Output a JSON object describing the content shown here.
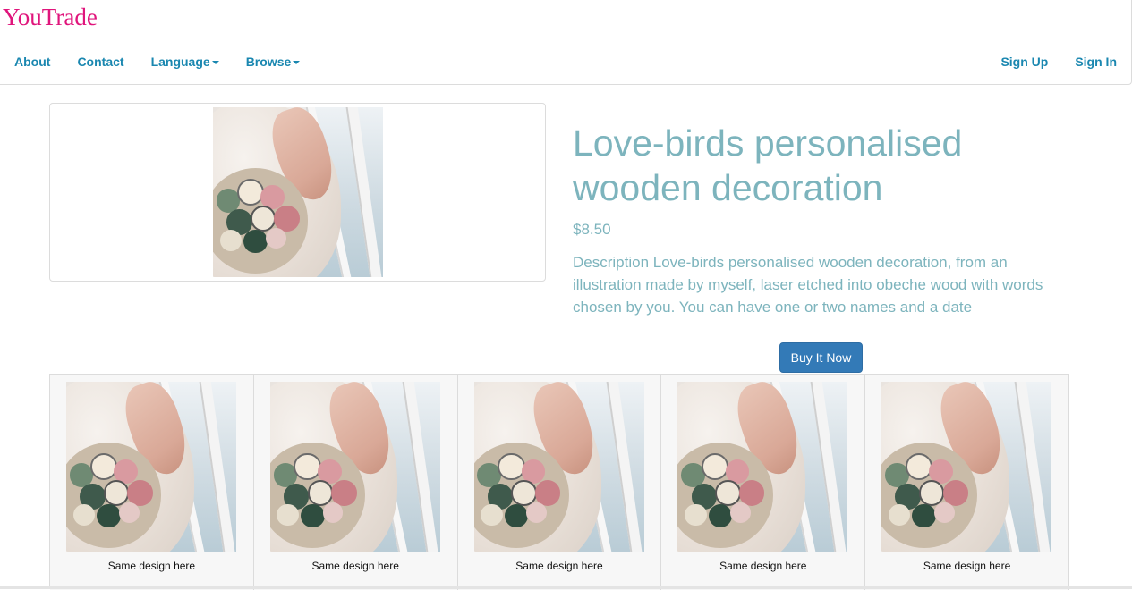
{
  "brand": {
    "name": "YouTrade",
    "color": "#e0157c"
  },
  "nav": {
    "left": [
      {
        "label": "About"
      },
      {
        "label": "Contact"
      },
      {
        "label": "Language",
        "dropdown": true
      },
      {
        "label": "Browse",
        "dropdown": true
      }
    ],
    "right": [
      {
        "label": "Sign Up"
      },
      {
        "label": "Sign In"
      }
    ],
    "link_color": "#1a87b0"
  },
  "product": {
    "title": "Love-birds personalised wooden decoration",
    "price": "$8.50",
    "description": "Description Love-birds personalised wooden decoration, from an illustration made by myself, laser etched into obeche wood with words chosen by you. You can have one or two names and a date",
    "buy_label": "Buy It Now",
    "image_icon": "bouquet-photo",
    "text_color": "#7db4bd",
    "button_color": "#337ab7"
  },
  "related": [
    {
      "caption": "Same design here",
      "image_icon": "bouquet-photo"
    },
    {
      "caption": "Same design here",
      "image_icon": "bouquet-photo"
    },
    {
      "caption": "Same design here",
      "image_icon": "bouquet-photo"
    },
    {
      "caption": "Same design here",
      "image_icon": "bouquet-photo"
    },
    {
      "caption": "Same design here",
      "image_icon": "bouquet-photo"
    }
  ]
}
